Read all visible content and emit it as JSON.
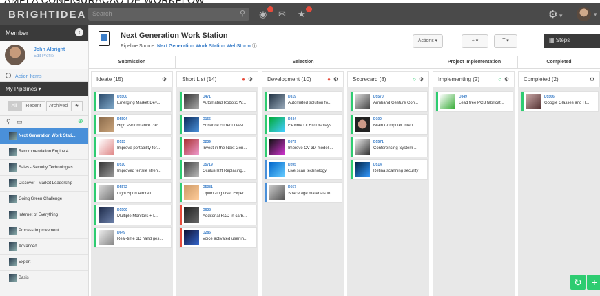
{
  "caption": "AMPLA CONFIGURAÇÃO DE WORKFLOW",
  "topbar": {
    "brand": "BRIGHTIDEA",
    "search_placeholder": "Search"
  },
  "sidebar": {
    "member_label": "Member",
    "user_name": "John Albright",
    "edit_profile": "Edit Profile",
    "action_items": "Action Items",
    "my_pipelines": "My Pipelines ▾",
    "filters": [
      "All",
      "Recent",
      "Archived"
    ],
    "pipelines": [
      "Next Generation Work Stati...",
      "Recommendation Engine 4...",
      "Sales - Security Technologies",
      "Discover - Market Leadership",
      "Going Green Challenge",
      "Internet of Everything",
      "Process Improvement",
      "Advanced",
      "Expert",
      "Basis"
    ]
  },
  "header": {
    "title": "Next Generation Work Station",
    "source_label": "Pipeline Source:",
    "source_link": "Next Generation Work Station WebStorm",
    "actions": "Actions ▾",
    "add": "+ ▾",
    "filter": "T ▾",
    "steps": "Steps"
  },
  "phases": [
    "Submission",
    "Selection",
    "Project Implementation",
    "Completed"
  ],
  "columns": [
    {
      "name": "Ideate (15)",
      "cards": [
        {
          "id": "D5500",
          "title": "Emerging Market Dev...",
          "color": "green"
        },
        {
          "id": "D5504",
          "title": "High Performance GP...",
          "color": "green"
        },
        {
          "id": "D513",
          "title": "Improve portability for...",
          "color": "green"
        },
        {
          "id": "D510",
          "title": "Improved tensile stren...",
          "color": "green"
        },
        {
          "id": "D5572",
          "title": "Light Sport Aircraft",
          "color": "green"
        },
        {
          "id": "D5500",
          "title": "Multiple Monitors + L...",
          "color": "green"
        },
        {
          "id": "D649",
          "title": "Real-time 3D hand ges...",
          "color": "green"
        }
      ]
    },
    {
      "name": "Short List (14)",
      "cards": [
        {
          "id": "D471",
          "title": "Automated Robotic W...",
          "color": "green"
        },
        {
          "id": "D155",
          "title": "Enhance current DAM...",
          "color": "green"
        },
        {
          "id": "D239",
          "title": "Invest in the Next Gen...",
          "color": "green"
        },
        {
          "id": "D5719",
          "title": "Oculus Rift Replacing...",
          "color": "green"
        },
        {
          "id": "D5381",
          "title": "Optimizing User Exper...",
          "color": "green"
        },
        {
          "id": "D638",
          "title": "Additonal R&D in carb...",
          "color": "red"
        },
        {
          "id": "D285",
          "title": "Voice activated user in...",
          "color": "red"
        }
      ]
    },
    {
      "name": "Development (10)",
      "cards": [
        {
          "id": "D319",
          "title": "Automated solution fo...",
          "color": "green"
        },
        {
          "id": "D344",
          "title": "Flexible OLED Displays",
          "color": "green"
        },
        {
          "id": "D579",
          "title": "Improve CV-3D modeli...",
          "color": "green"
        },
        {
          "id": "D205",
          "title": "Live scan technology",
          "color": "blue"
        },
        {
          "id": "D567",
          "title": "Space age materials fo...",
          "color": "blue"
        }
      ]
    },
    {
      "name": "Scorecard (8)",
      "cards": [
        {
          "id": "D5570",
          "title": "Armband Gesture Con...",
          "color": "green"
        },
        {
          "id": "D100",
          "title": "Brain Computer Interf...",
          "color": "green"
        },
        {
          "id": "D5571",
          "title": "Conferencing System ...",
          "color": "green"
        },
        {
          "id": "D514",
          "title": "Retina scanning security",
          "color": "green"
        }
      ]
    },
    {
      "name": "Implementing (2)",
      "cards": [
        {
          "id": "D349",
          "title": "Lead free PCB fabricat...",
          "color": "green"
        }
      ]
    },
    {
      "name": "Completed (2)",
      "cards": [
        {
          "id": "D5566",
          "title": "Google Glasses and H...",
          "color": "green"
        }
      ]
    }
  ]
}
